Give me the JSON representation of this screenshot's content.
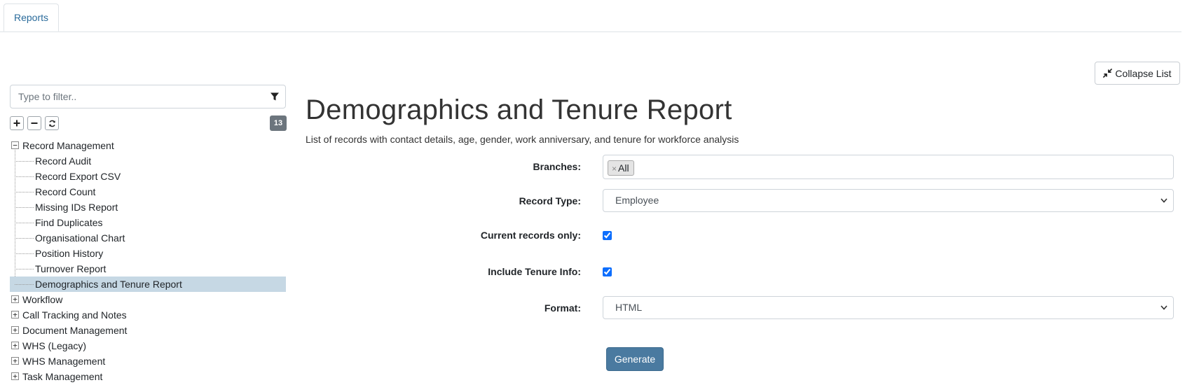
{
  "tabs": [
    {
      "label": "Reports"
    }
  ],
  "toolbar": {
    "collapse_label": "Collapse List"
  },
  "sidebar": {
    "filter_placeholder": "Type to filter..",
    "count": "13",
    "groups": [
      {
        "label": "Record Management",
        "expanded": true,
        "items": [
          {
            "label": "Record Audit"
          },
          {
            "label": "Record Export CSV"
          },
          {
            "label": "Record Count"
          },
          {
            "label": "Missing IDs Report"
          },
          {
            "label": "Find Duplicates"
          },
          {
            "label": "Organisational Chart"
          },
          {
            "label": "Position History"
          },
          {
            "label": "Turnover Report"
          },
          {
            "label": "Demographics and Tenure Report",
            "selected": true
          }
        ]
      },
      {
        "label": "Workflow"
      },
      {
        "label": "Call Tracking and Notes"
      },
      {
        "label": "Document Management"
      },
      {
        "label": "WHS (Legacy)"
      },
      {
        "label": "WHS Management"
      },
      {
        "label": "Task Management"
      }
    ]
  },
  "main": {
    "title": "Demographics and Tenure Report",
    "subtitle": "List of records with contact details, age, gender, work anniversary, and tenure for workforce analysis",
    "form": {
      "branches_label": "Branches:",
      "branches_chip": "All",
      "record_type_label": "Record Type:",
      "record_type_value": "Employee",
      "current_only_label": "Current records only:",
      "current_only_checked": true,
      "tenure_label": "Include Tenure Info:",
      "tenure_checked": true,
      "format_label": "Format:",
      "format_value": "HTML",
      "generate_label": "Generate"
    }
  },
  "colors": {
    "accent": "#4a7aa0",
    "tab_text": "#2a6b9b",
    "selected_row": "#c6d8e4",
    "badge": "#6c757d"
  }
}
